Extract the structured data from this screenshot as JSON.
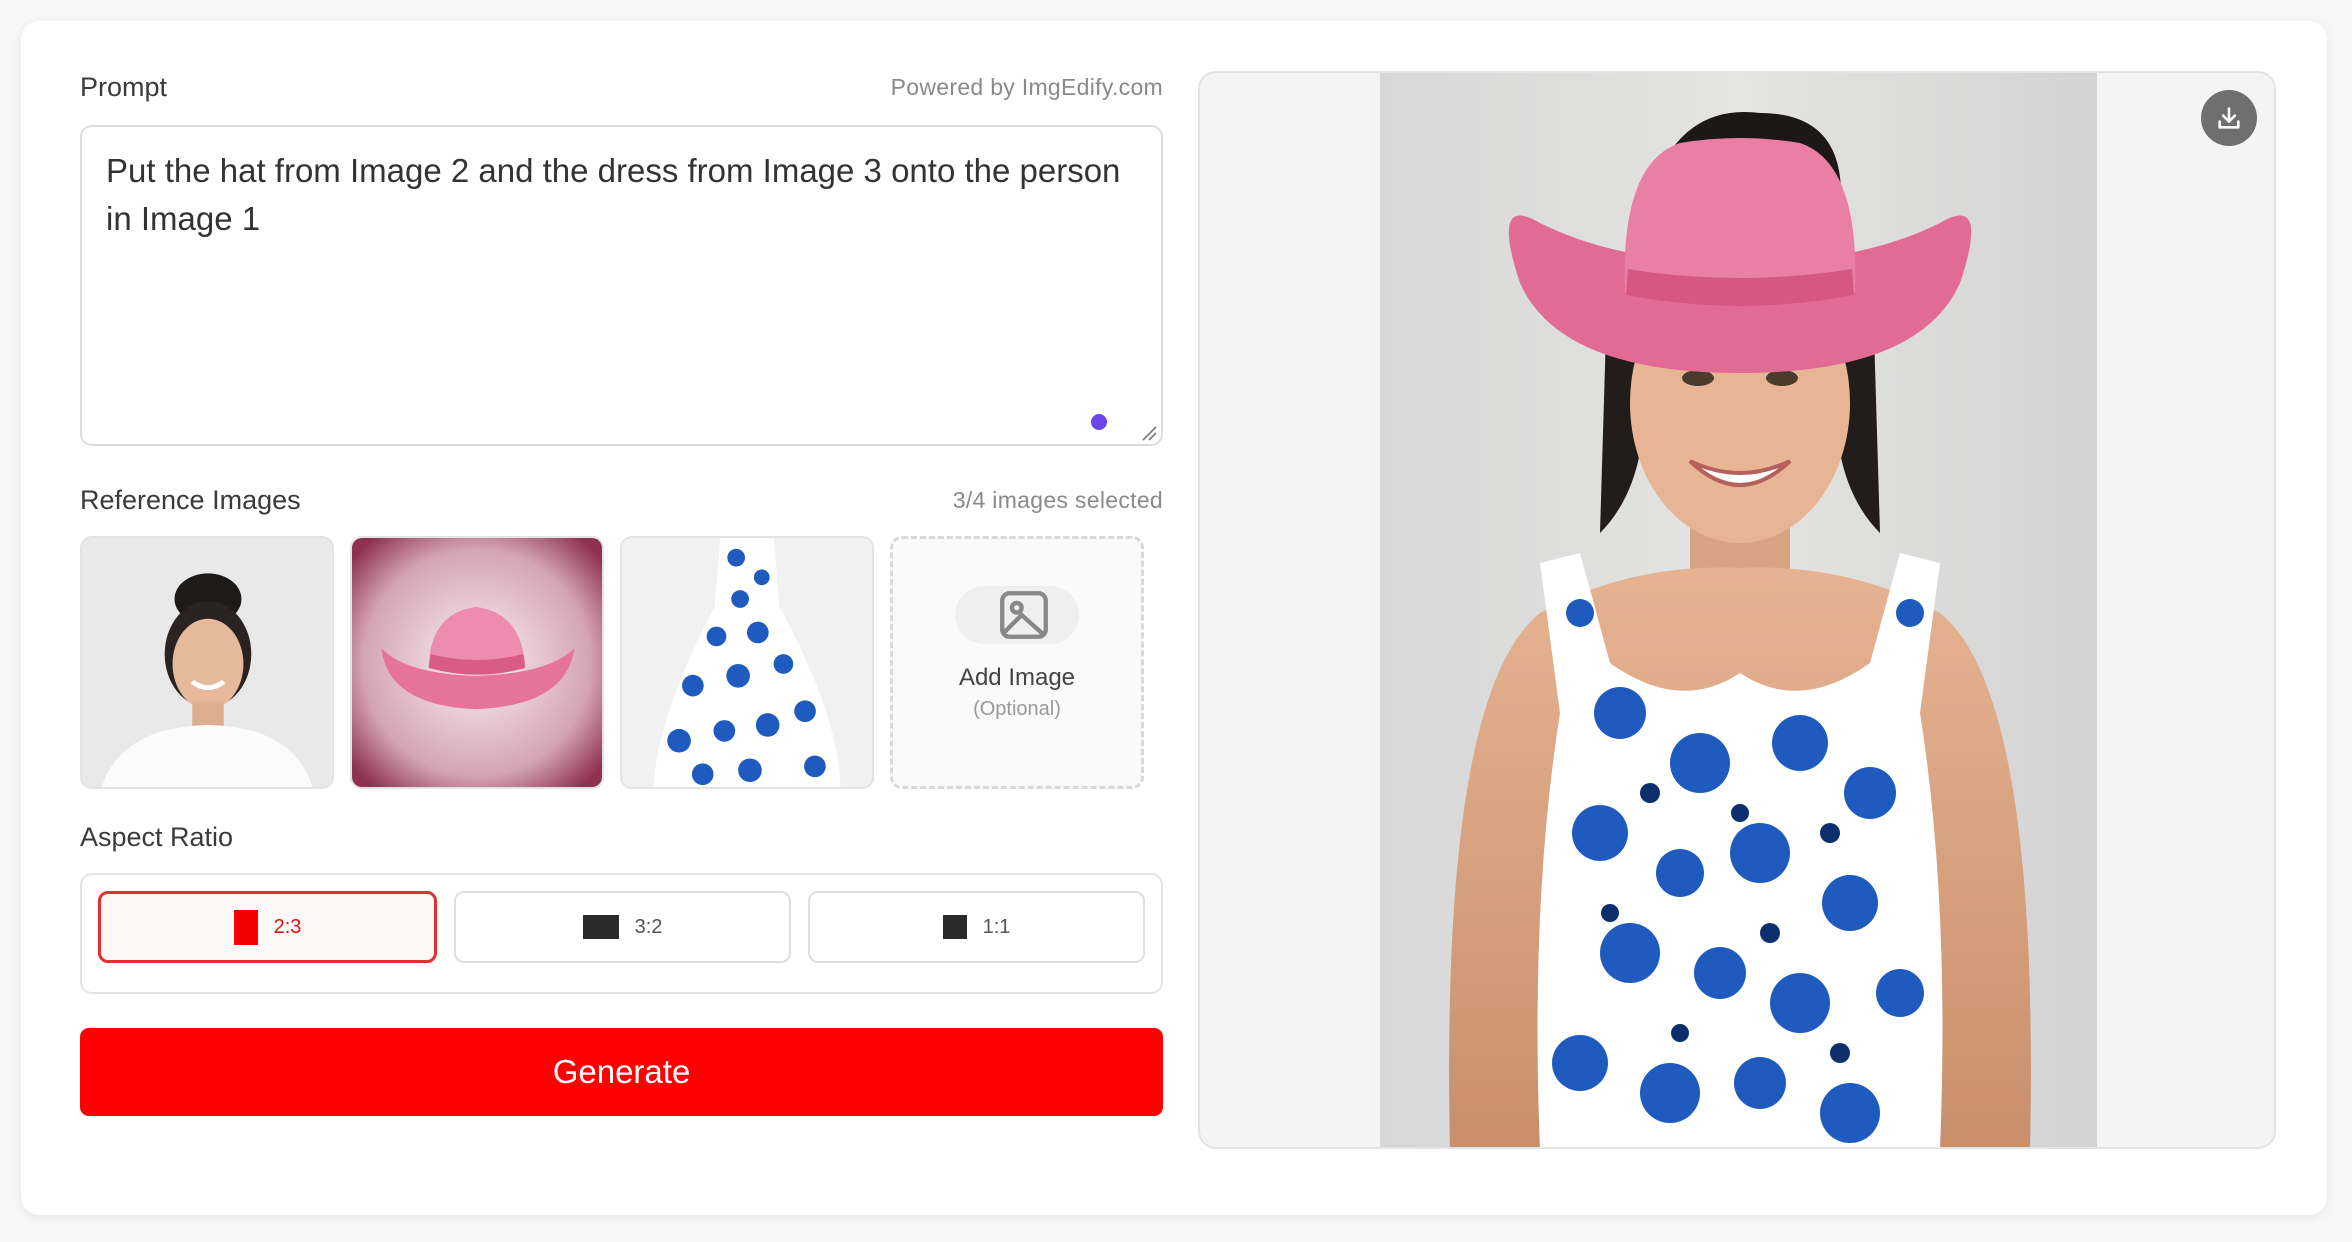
{
  "prompt": {
    "label": "Prompt",
    "powered_by": "Powered by ImgEdify.com",
    "text": "Put the hat from Image 2 and the dress from Image 3 onto the person in Image 1"
  },
  "references": {
    "label": "Reference Images",
    "count_text": "3/4 images selected",
    "add_label": "Add Image",
    "add_sub": "(Optional)"
  },
  "aspect_ratio": {
    "label": "Aspect Ratio",
    "options": [
      "2:3",
      "3:2",
      "1:1"
    ],
    "selected": "2:3"
  },
  "generate_label": "Generate",
  "colors": {
    "accent": "#ff0000",
    "dot": "#6b46e8",
    "hat_pink": "#e4668f",
    "dress_blue": "#1f5bbf"
  },
  "icons": {
    "add": "image-icon",
    "download": "download-icon"
  }
}
